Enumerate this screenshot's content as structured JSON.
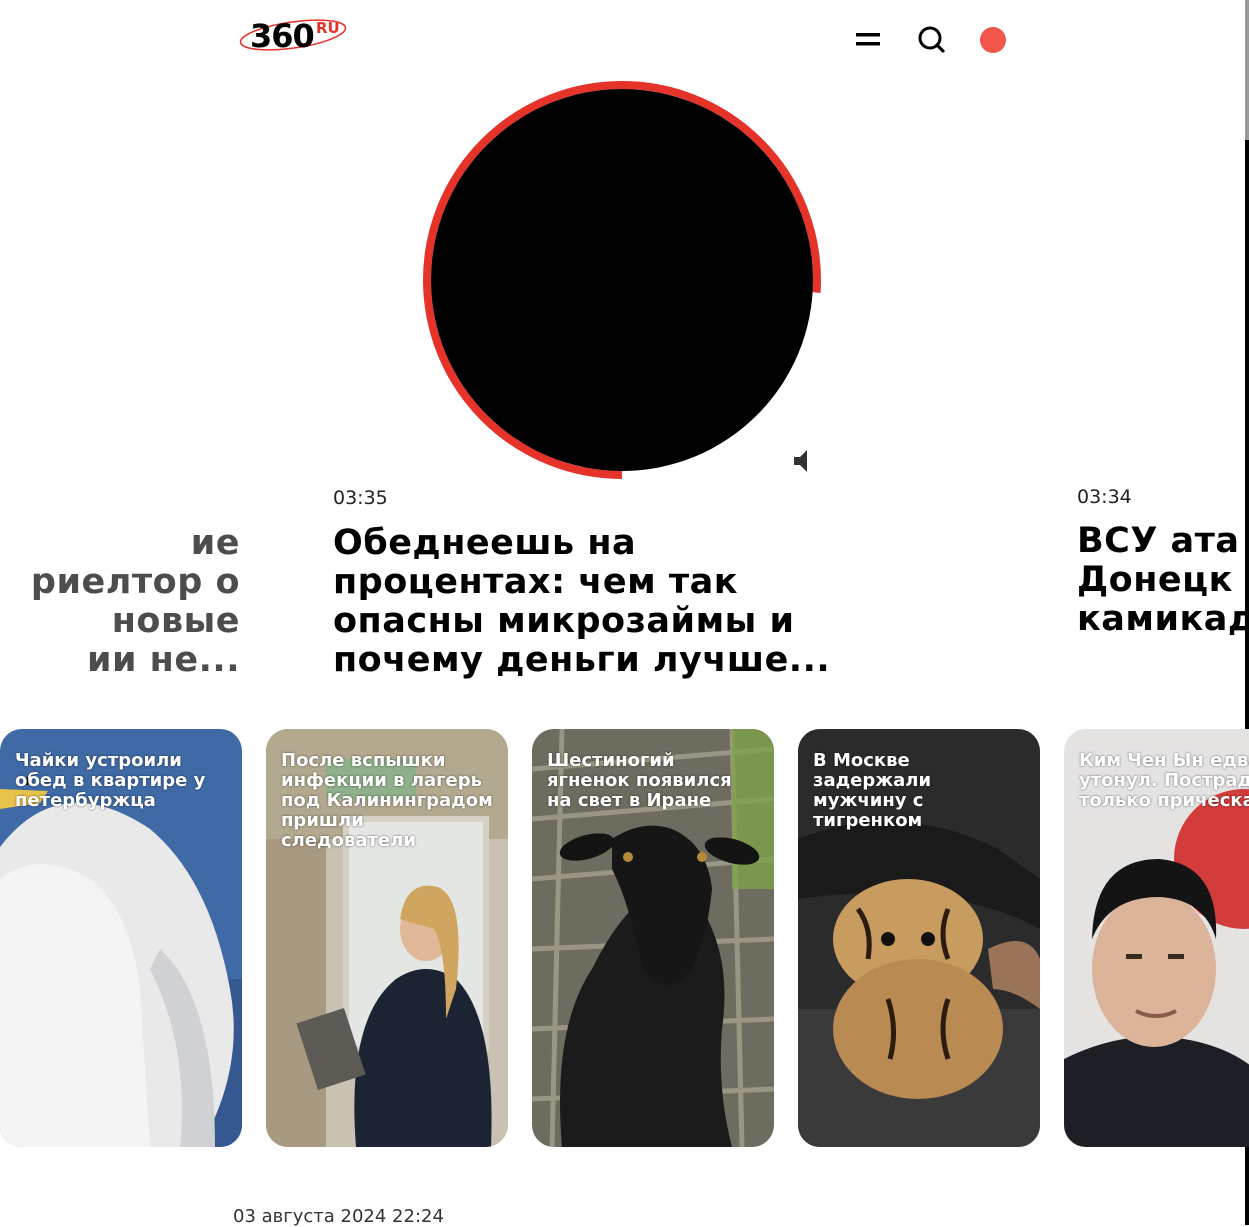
{
  "header": {
    "logo_text": "360",
    "logo_suffix": "RU",
    "icons": [
      "menu-icon",
      "search-icon",
      "live-dot-icon"
    ]
  },
  "player": {
    "progress_fraction": 0.76,
    "accent_color": "#e6332a",
    "icons": [
      "speaker-icon"
    ]
  },
  "stories": {
    "left": {
      "title_lines": [
        "ие",
        "риелтор о",
        "новые",
        "ии не..."
      ]
    },
    "main": {
      "time": "03:35",
      "title": "Обеднеешь на процентах: чем так опасны микрозаймы и почему деньги лучше..."
    },
    "right": {
      "time": "03:34",
      "title_lines": [
        "ВСУ ата",
        "Донецк",
        "камикад"
      ]
    }
  },
  "cards": [
    {
      "title": "Чайки устроили обед в квартире у петербуржца"
    },
    {
      "title": "После вспышки инфекции в лагерь под Калининградом пришли следователи"
    },
    {
      "title": "Шестиногий ягненок появился на свет в Иране"
    },
    {
      "title": "В Москве задержали мужчину с тигренком"
    },
    {
      "title": "Ким Чен Ын едва не утонул. Пострадала только прическа"
    }
  ],
  "footer": {
    "date": "03 августа 2024 22:24"
  }
}
